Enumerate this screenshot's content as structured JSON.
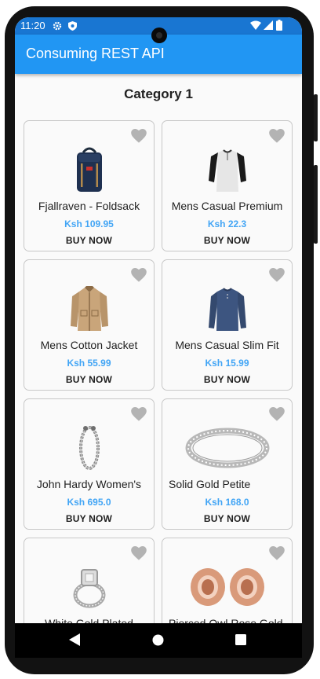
{
  "status_bar": {
    "time": "11:20",
    "icons": [
      "gear-icon",
      "shield-icon",
      "wifi-icon",
      "signal-icon",
      "battery-icon"
    ]
  },
  "app_bar": {
    "title": "Consuming REST API",
    "color": "#2196f3"
  },
  "section": {
    "title": "Category 1"
  },
  "products": [
    {
      "name": "Fjallraven - Foldsack",
      "price": "Ksh 109.95",
      "buy": "BUY NOW",
      "icon": "backpack"
    },
    {
      "name": "Mens Casual Premium",
      "price": "Ksh 22.3",
      "buy": "BUY NOW",
      "icon": "tshirt"
    },
    {
      "name": "Mens Cotton Jacket",
      "price": "Ksh 55.99",
      "buy": "BUY NOW",
      "icon": "jacket"
    },
    {
      "name": "Mens Casual Slim Fit",
      "price": "Ksh 15.99",
      "buy": "BUY NOW",
      "icon": "longsleeve"
    },
    {
      "name": "John Hardy Women's",
      "price": "Ksh 695.0",
      "buy": "BUY NOW",
      "icon": "bracelet"
    },
    {
      "name": "Solid Gold Petite",
      "price": "Ksh 168.0",
      "buy": "BUY NOW",
      "icon": "ring"
    },
    {
      "name": "White Gold Plated",
      "price": "",
      "buy": "",
      "icon": "diamond-ring"
    },
    {
      "name": "Pierced Owl Rose Gold",
      "price": "",
      "buy": "",
      "icon": "plugs"
    }
  ],
  "colors": {
    "price": "#42a5f5",
    "heart": "#b3b3b3",
    "status_bar": "#1976d2"
  },
  "nav_bar": {
    "buttons": [
      "back-icon",
      "home-icon",
      "recents-icon"
    ]
  }
}
